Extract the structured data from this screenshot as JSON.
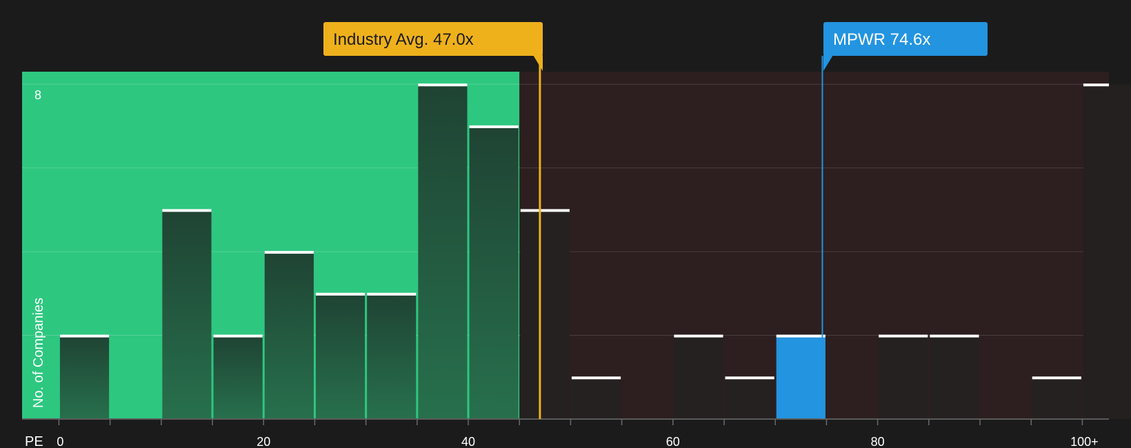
{
  "chart_data": {
    "type": "bar",
    "title": "",
    "xlabel": "PE",
    "ylabel": "No. of Companies",
    "x_ticks": [
      {
        "value": 0,
        "label": "0"
      },
      {
        "value": 20,
        "label": "20"
      },
      {
        "value": 40,
        "label": "40"
      },
      {
        "value": 60,
        "label": "60"
      },
      {
        "value": 80,
        "label": "80"
      },
      {
        "value": 100,
        "label": "100+"
      }
    ],
    "y_ticks": [
      {
        "value": 8,
        "label": "8"
      }
    ],
    "xlim": [
      -3.6,
      102.6
    ],
    "ylim": [
      0,
      8.3
    ],
    "bin_width": 5,
    "bins": [
      {
        "start": 0,
        "end": 5,
        "count": 2
      },
      {
        "start": 5,
        "end": 10,
        "count": 0
      },
      {
        "start": 10,
        "end": 15,
        "count": 5
      },
      {
        "start": 15,
        "end": 20,
        "count": 2
      },
      {
        "start": 20,
        "end": 25,
        "count": 4
      },
      {
        "start": 25,
        "end": 30,
        "count": 3
      },
      {
        "start": 30,
        "end": 35,
        "count": 3
      },
      {
        "start": 35,
        "end": 40,
        "count": 8
      },
      {
        "start": 40,
        "end": 45,
        "count": 7
      },
      {
        "start": 45,
        "end": 50,
        "count": 5
      },
      {
        "start": 50,
        "end": 55,
        "count": 1
      },
      {
        "start": 55,
        "end": 60,
        "count": 0
      },
      {
        "start": 60,
        "end": 65,
        "count": 2
      },
      {
        "start": 65,
        "end": 70,
        "count": 1
      },
      {
        "start": 70,
        "end": 75,
        "count": 2,
        "highlight": true
      },
      {
        "start": 75,
        "end": 80,
        "count": 0
      },
      {
        "start": 80,
        "end": 85,
        "count": 2
      },
      {
        "start": 85,
        "end": 90,
        "count": 2
      },
      {
        "start": 90,
        "end": 95,
        "count": 0
      },
      {
        "start": 95,
        "end": 100,
        "count": 1
      },
      {
        "start": 100,
        "end": 105,
        "count": 8
      }
    ],
    "shaded_regions": [
      {
        "from": -3.6,
        "to": 45,
        "color": "#2ec780"
      },
      {
        "from": 45,
        "to": 102.6,
        "color": "#2d1f1f"
      }
    ],
    "markers": [
      {
        "label": "Industry Avg. 47.0x",
        "value": 47.0,
        "color": "#eeb11c",
        "text_color": "#1b1b1b"
      },
      {
        "label": "MPWR 74.6x",
        "value": 74.6,
        "color": "#2394e0",
        "text_color": "#ffffff"
      }
    ],
    "grid": true,
    "colors": {
      "background": "#1b1b1b",
      "bar_in_green": "#214d39",
      "bar_default": "#252121",
      "bar_highlight": "#2394e0",
      "bar_top": "#ffffff"
    }
  }
}
